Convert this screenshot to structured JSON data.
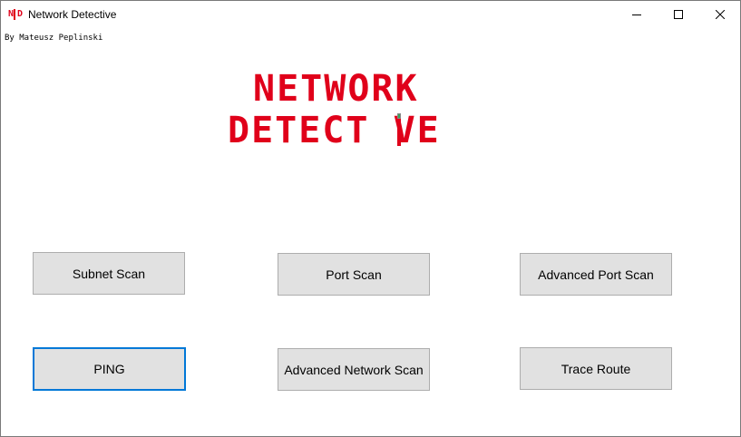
{
  "window": {
    "title": "Network Detective",
    "app_icon_text": "N D",
    "controls": {
      "minimize": "minimize-icon",
      "maximize": "maximize-icon",
      "close": "close-icon"
    }
  },
  "author": "By Mateusz Peplinski",
  "logo": {
    "line1": "NETWORK",
    "line2": "DETECT VE"
  },
  "buttons": {
    "subnet_scan": "Subnet Scan",
    "port_scan": "Port Scan",
    "advanced_port_scan": "Advanced Port Scan",
    "ping": "PING",
    "advanced_network_scan": "Advanced Network Scan",
    "trace_route": "Trace Route"
  },
  "colors": {
    "brand_red": "#e0001a",
    "focus_blue": "#0078d7",
    "button_bg": "#e1e1e1"
  }
}
